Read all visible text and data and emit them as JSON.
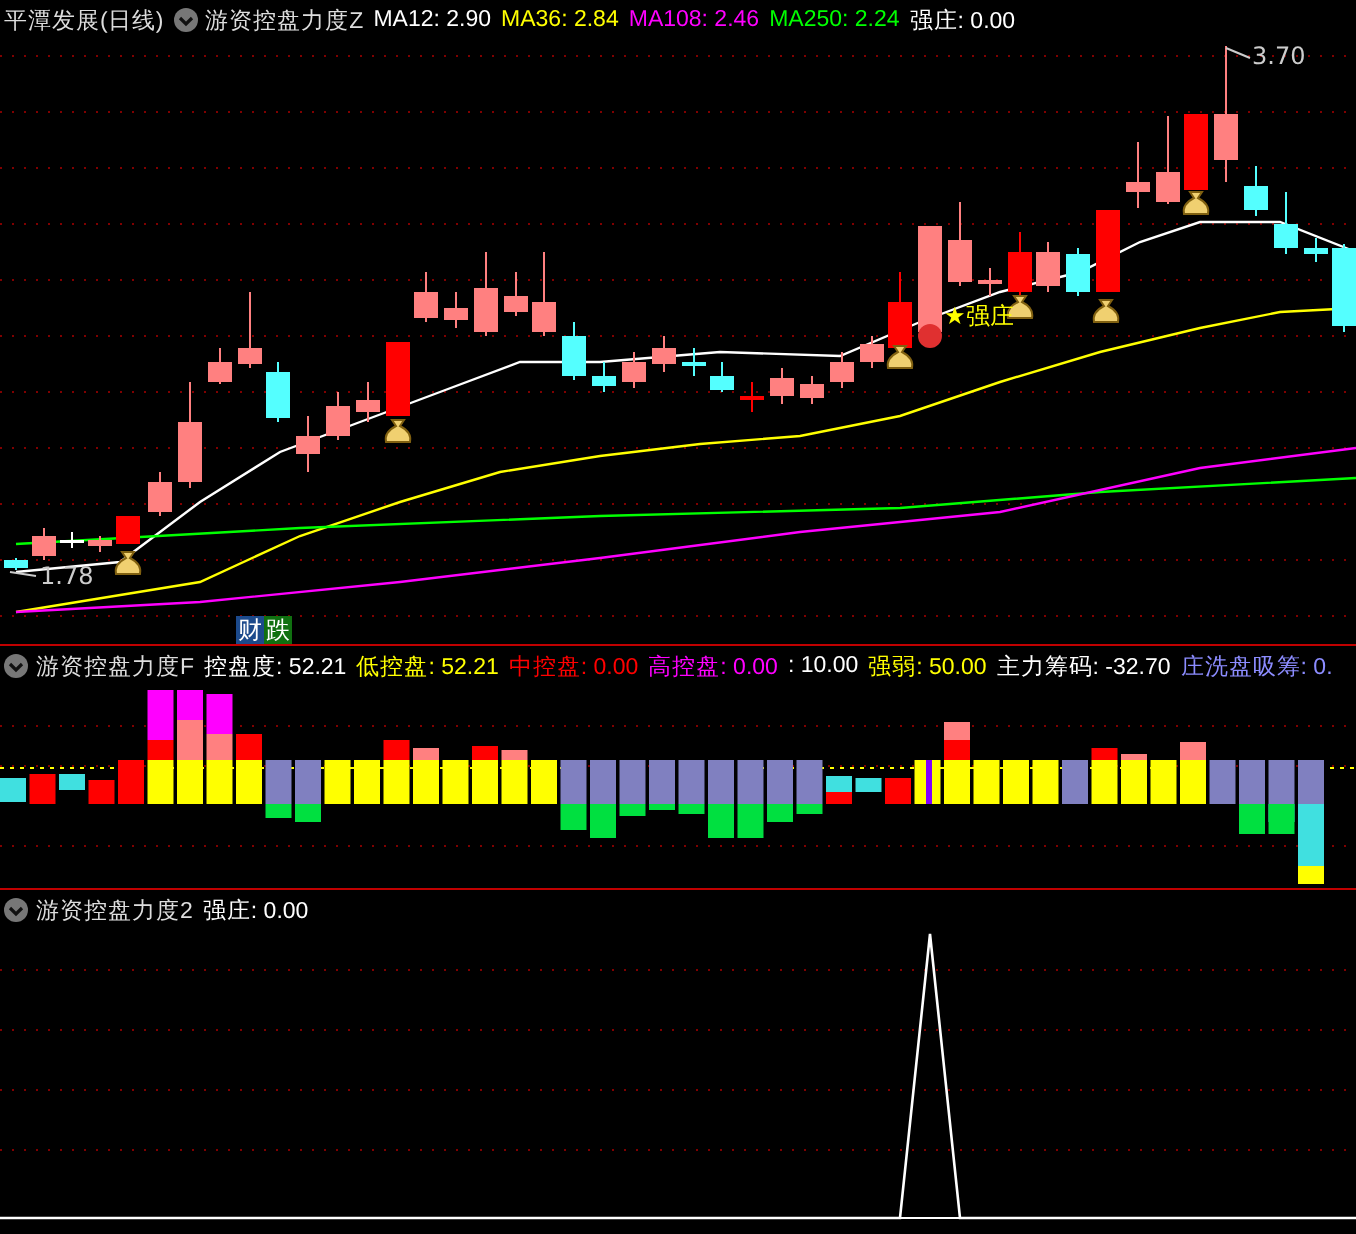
{
  "panels": [
    {
      "kind": "price",
      "stock_title": "平潭发展(日线)",
      "indicator": "游资控盘力度Z",
      "readings": [
        {
          "text": "MA12: 2.90",
          "color": "#ffffff"
        },
        {
          "text": "MA36: 2.84",
          "color": "#ffff00"
        },
        {
          "text": "MA108: 2.46",
          "color": "#ff00ff"
        },
        {
          "text": "MA250: 2.24",
          "color": "#00ff00"
        },
        {
          "text": "强庄: 0.00",
          "color": "#ffffff"
        }
      ],
      "high_label": "3.70",
      "low_label": "1.78",
      "signal_label": "★强庄",
      "badges": [
        {
          "text": "财",
          "color": "#1c4a8c"
        },
        {
          "text": "跌",
          "color": "#107010"
        }
      ]
    },
    {
      "kind": "bars",
      "indicator": "游资控盘力度F",
      "readings": [
        {
          "text": "控盘度: 52.21",
          "color": "#ffffff"
        },
        {
          "text": "低控盘: 52.21",
          "color": "#ffff00"
        },
        {
          "text": "中控盘: 0.00",
          "color": "#ff0000"
        },
        {
          "text": "高控盘: 0.00",
          "color": "#ff00ff"
        },
        {
          "text": ": 10.00",
          "color": "#ffffff"
        },
        {
          "text": "强弱: 50.00",
          "color": "#ffff00"
        },
        {
          "text": "主力筹码: -32.70",
          "color": "#ffffff"
        },
        {
          "text": "庄洗盘吸筹: 0.",
          "color": "#8c8cff"
        }
      ]
    },
    {
      "kind": "spike",
      "indicator": "游资控盘力度2",
      "readings": [
        {
          "text": "强庄: 0.00",
          "color": "#ffffff"
        }
      ]
    }
  ]
}
